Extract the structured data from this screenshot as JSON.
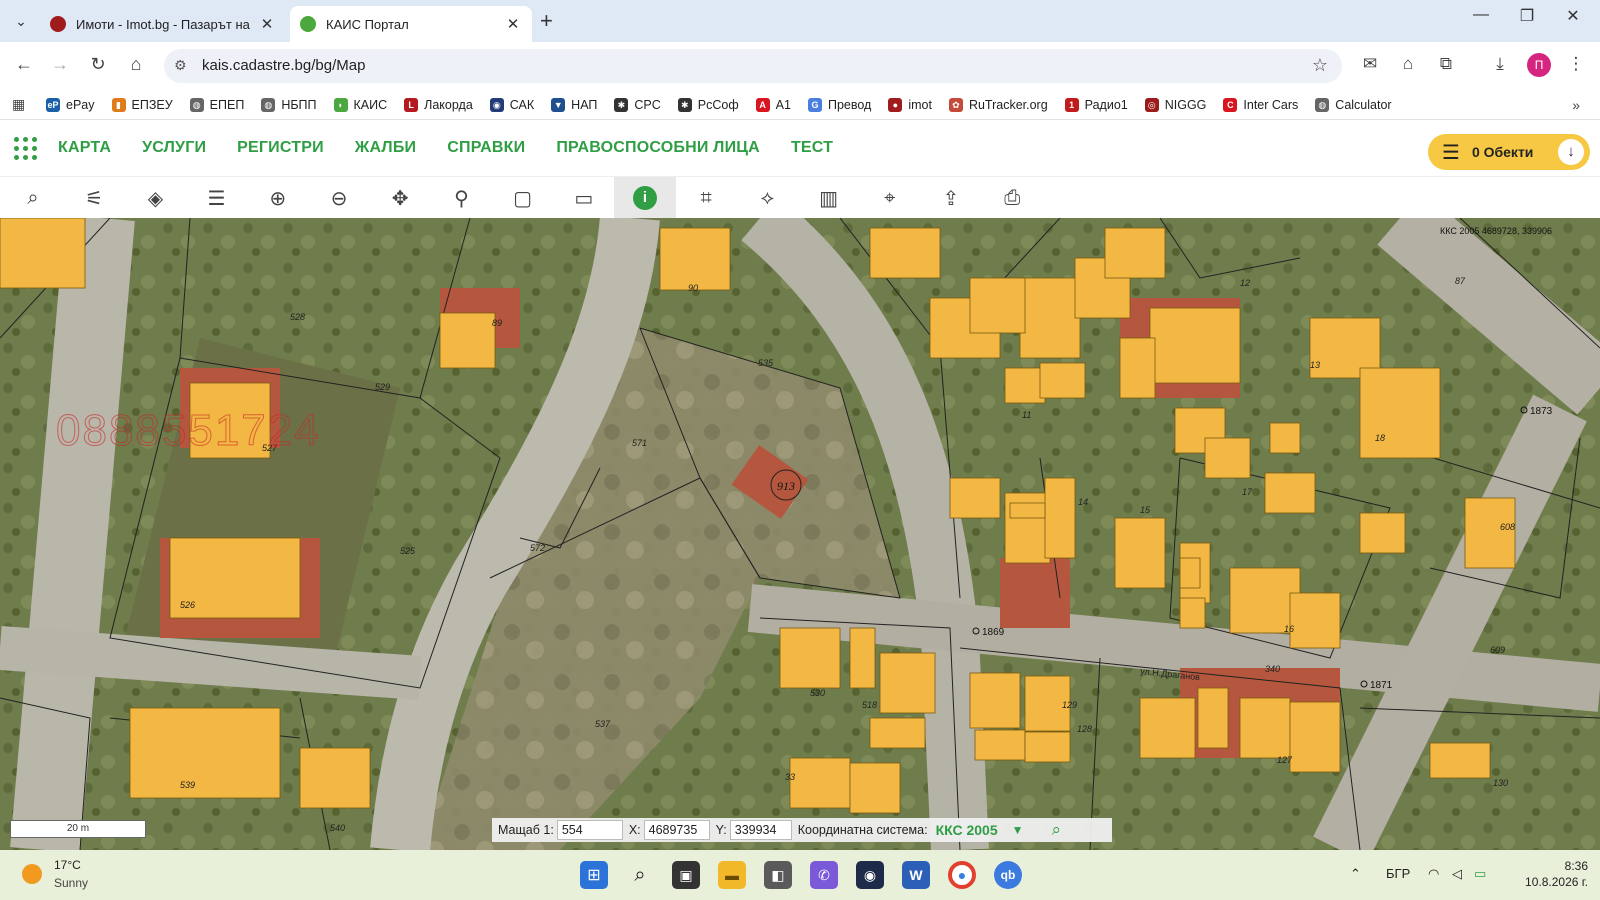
{
  "browser": {
    "tabs": [
      {
        "title": "Имоти - Imot.bg - Пазарът на",
        "active": false,
        "favicon_color": "#a01c1c"
      },
      {
        "title": "КАИС Портал",
        "active": true,
        "favicon_color": "#4aa83f"
      }
    ],
    "url": "kais.cadastre.bg/bg/Map",
    "profile_initial": "П"
  },
  "bookmarks": [
    {
      "label": "ePay",
      "icon": "epay-icon",
      "color": "#1a5fa8",
      "glyph": "eP"
    },
    {
      "label": "ЕПЗЕУ",
      "icon": "epzeu-icon",
      "color": "#e07b1a",
      "glyph": "▮"
    },
    {
      "label": "ЕПЕП",
      "icon": "globe-icon",
      "color": "#666",
      "glyph": "◍"
    },
    {
      "label": "НБПП",
      "icon": "globe-icon",
      "color": "#666",
      "glyph": "◍"
    },
    {
      "label": "КАИС",
      "icon": "kais-icon",
      "color": "#4aa83f",
      "glyph": "◗"
    },
    {
      "label": "Лакорда",
      "icon": "lakorda-icon",
      "color": "#b3191f",
      "glyph": "L"
    },
    {
      "label": "САК",
      "icon": "sak-icon",
      "color": "#223c7a",
      "glyph": "◉"
    },
    {
      "label": "НАП",
      "icon": "nap-icon",
      "color": "#1f4f8f",
      "glyph": "▼"
    },
    {
      "label": "CPC",
      "icon": "cpc-icon",
      "color": "#333",
      "glyph": "✱"
    },
    {
      "label": "РсСоф",
      "icon": "rssof-icon",
      "color": "#333",
      "glyph": "✱"
    },
    {
      "label": "A1",
      "icon": "a1-icon",
      "color": "#d9161f",
      "glyph": "A"
    },
    {
      "label": "Превод",
      "icon": "translate-icon",
      "color": "#4a7fe0",
      "glyph": "G"
    },
    {
      "label": "imot",
      "icon": "imot-icon",
      "color": "#a01c1c",
      "glyph": "●"
    },
    {
      "label": "RuTracker.org",
      "icon": "rutracker-icon",
      "color": "#c64a3a",
      "glyph": "✿"
    },
    {
      "label": "Радио1",
      "icon": "radio1-icon",
      "color": "#c21b1b",
      "glyph": "1"
    },
    {
      "label": "NIGGG",
      "icon": "niggg-icon",
      "color": "#9c1b1b",
      "glyph": "◎"
    },
    {
      "label": "Inter Cars",
      "icon": "intercars-icon",
      "color": "#d9161f",
      "glyph": "C"
    },
    {
      "label": "Calculator",
      "icon": "globe-icon",
      "color": "#666",
      "glyph": "◍"
    }
  ],
  "app": {
    "menu": [
      "КАРТА",
      "УСЛУГИ",
      "РЕГИСТРИ",
      "ЖАЛБИ",
      "СПРАВКИ",
      "ПРАВОСПОСОБНИ ЛИЦА",
      "ТЕСТ"
    ],
    "objects_button": "0 Обекти",
    "brand_color": "#2f9e44",
    "accent_color": "#f7c843"
  },
  "toolbar": [
    {
      "name": "search-tool-icon",
      "glyph": "⌕",
      "active": false
    },
    {
      "name": "route-tool-icon",
      "glyph": "⚟",
      "active": false
    },
    {
      "name": "layers-single-icon",
      "glyph": "◈",
      "active": false
    },
    {
      "name": "layers-stack-icon",
      "glyph": "☰",
      "active": false
    },
    {
      "name": "zoom-in-icon",
      "glyph": "⊕",
      "active": false
    },
    {
      "name": "zoom-out-icon",
      "glyph": "⊖",
      "active": false
    },
    {
      "name": "pan-icon",
      "glyph": "✥",
      "active": false
    },
    {
      "name": "location-pin-icon",
      "glyph": "⚲",
      "active": false
    },
    {
      "name": "select-add-icon",
      "glyph": "▢",
      "active": false
    },
    {
      "name": "select-remove-icon",
      "glyph": "▭",
      "active": false
    },
    {
      "name": "info-icon",
      "glyph": "i",
      "active": true
    },
    {
      "name": "measure-icon",
      "glyph": "⌗",
      "active": false
    },
    {
      "name": "polygon-icon",
      "glyph": "⟡",
      "active": false
    },
    {
      "name": "map-icon",
      "glyph": "▥",
      "active": false
    },
    {
      "name": "coordinates-icon",
      "glyph": "⌖",
      "active": false
    },
    {
      "name": "export-icon",
      "glyph": "⇪",
      "active": false
    },
    {
      "name": "print-icon",
      "glyph": "⎙",
      "active": false
    }
  ],
  "map": {
    "crs_label": "ККС 2005 4689728, 339906",
    "watermark": "0888551724",
    "scale_bar": "20 m",
    "parcel_numbers": [
      "528",
      "529",
      "89",
      "527",
      "525",
      "526",
      "535",
      "571",
      "572",
      "537",
      "539",
      "540",
      "530",
      "518",
      "90",
      "12",
      "87",
      "13",
      "18",
      "11",
      "17",
      "14",
      "15",
      "16",
      "129",
      "128",
      "127",
      "130",
      "608",
      "609",
      "340",
      "33"
    ],
    "points": [
      "1873",
      "1869",
      "1871"
    ],
    "selected_parcel": "913",
    "street": "ул.Н.Драганов",
    "status": {
      "scale_label": "Мащаб 1:",
      "scale_value": "554",
      "x_label": "X:",
      "x_value": "4689735",
      "y_label": "Y:",
      "y_value": "339934",
      "crs_label": "Координатна система:",
      "crs_value": "ККС 2005"
    }
  },
  "taskbar": {
    "weather_temp": "17°C",
    "weather_desc": "Sunny",
    "language": "БГР",
    "time": "8:36",
    "date": "10.8.2026 г."
  }
}
